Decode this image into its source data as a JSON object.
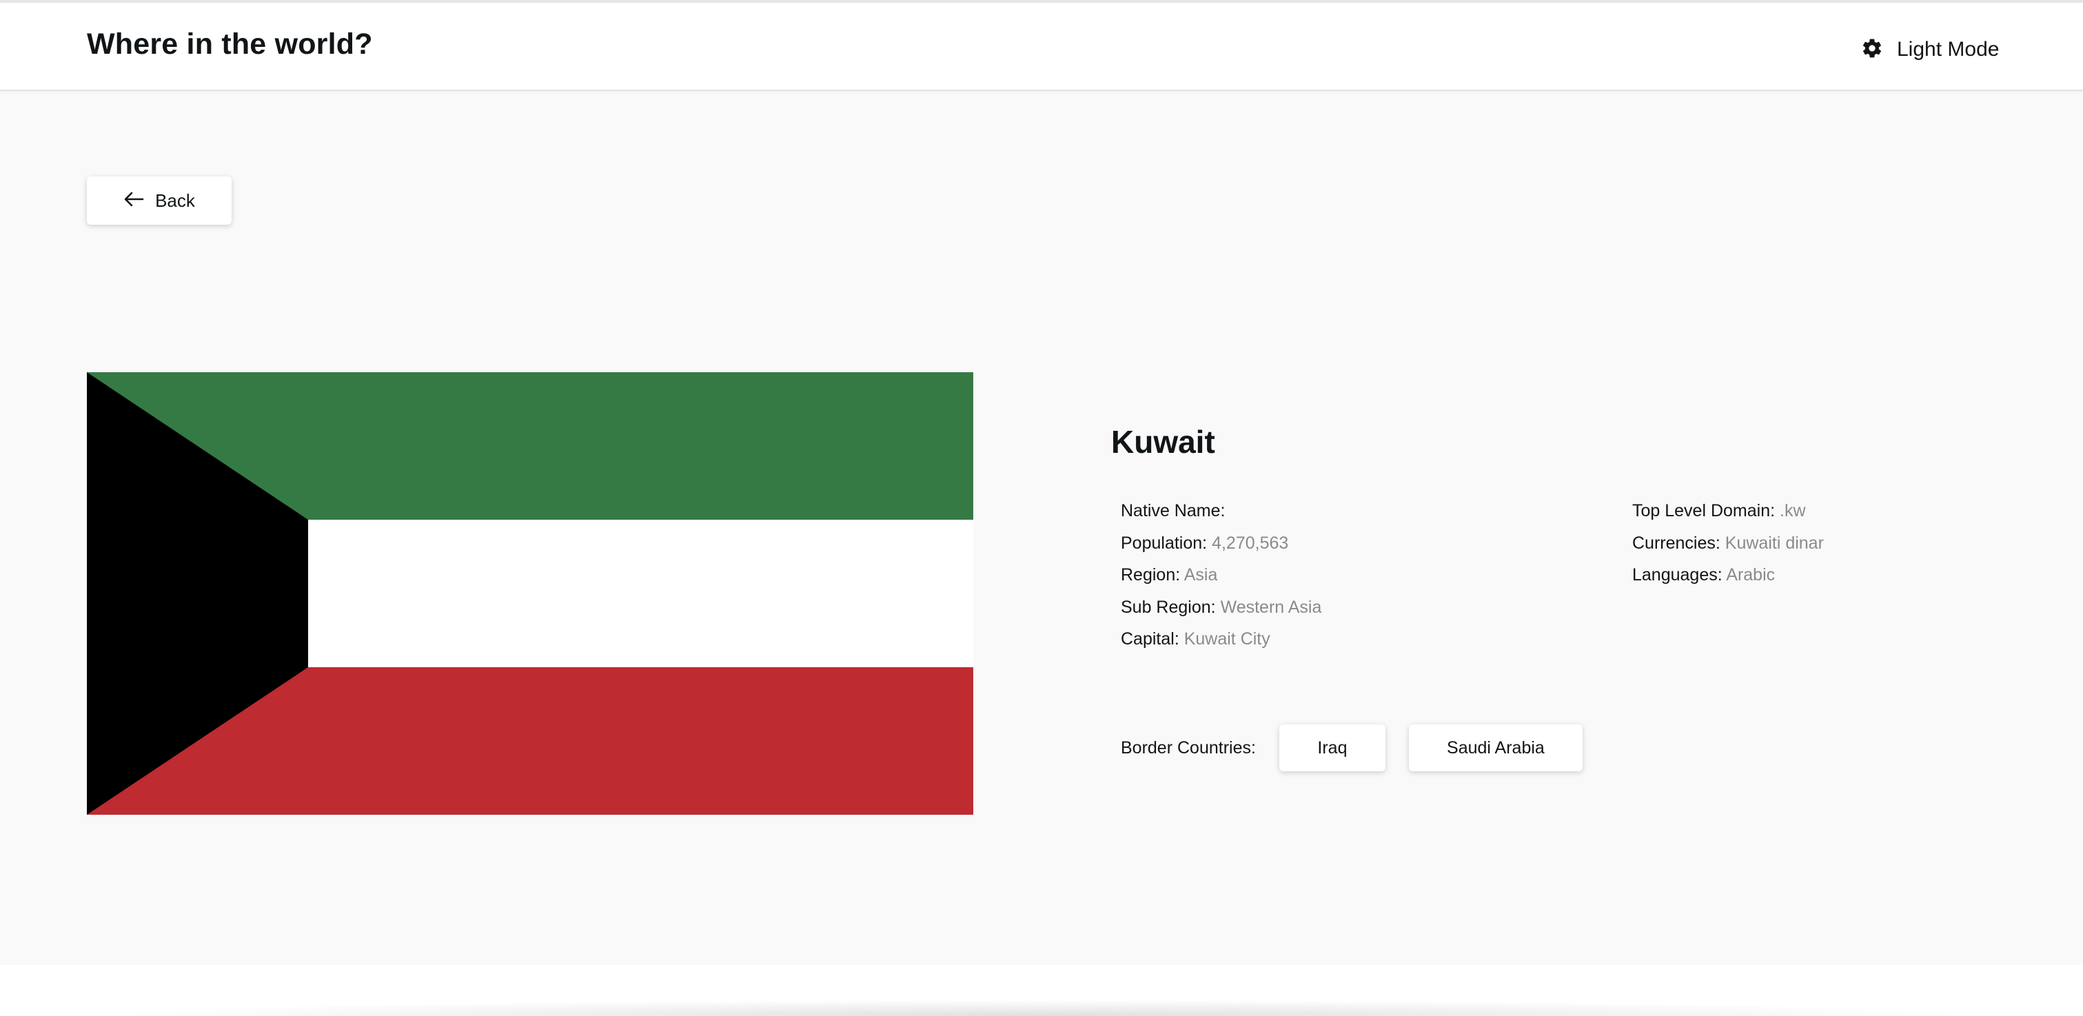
{
  "header": {
    "title": "Where in the world?",
    "theme_icon": "gear-icon",
    "theme_label": "Light Mode"
  },
  "back_button": {
    "icon": "arrow-left-icon",
    "label": "Back"
  },
  "country": {
    "name": "Kuwait",
    "flag_colors": {
      "green": "#357a45",
      "white": "#ffffff",
      "red": "#be2b30",
      "black": "#000000"
    },
    "details_left": [
      {
        "label": "Native Name:",
        "value": ""
      },
      {
        "label": "Population:",
        "value": "4,270,563"
      },
      {
        "label": "Region:",
        "value": "Asia"
      },
      {
        "label": "Sub Region:",
        "value": "Western Asia"
      },
      {
        "label": "Capital:",
        "value": "Kuwait City"
      }
    ],
    "details_right": [
      {
        "label": "Top Level Domain:",
        "value": ".kw"
      },
      {
        "label": "Currencies:",
        "value": "Kuwaiti dinar"
      },
      {
        "label": "Languages:",
        "value": "Arabic"
      }
    ],
    "borders_label": "Border Countries:",
    "border_countries": [
      "Iraq",
      "Saudi Arabia"
    ]
  }
}
